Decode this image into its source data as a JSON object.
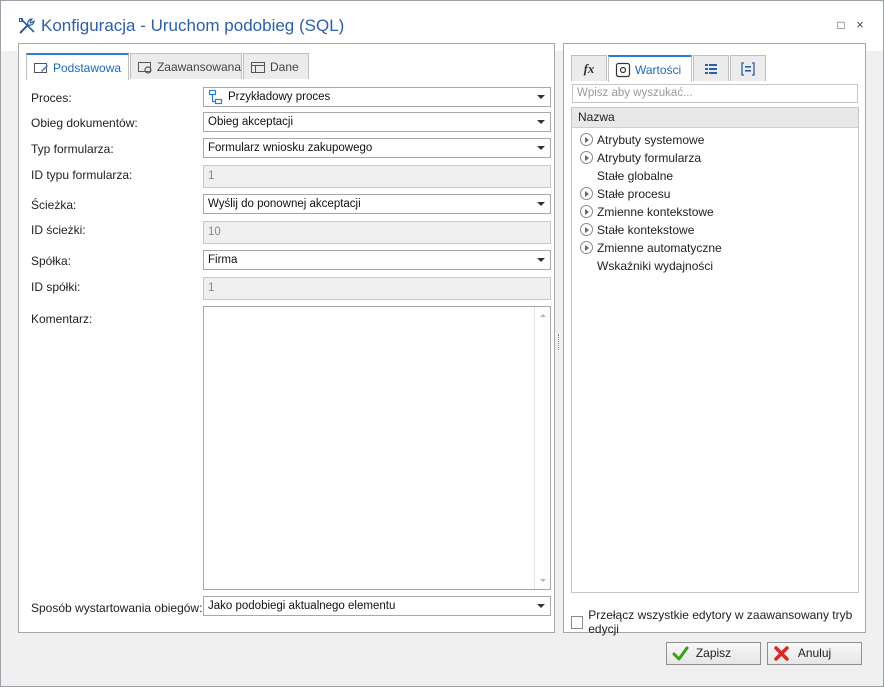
{
  "window": {
    "title": "Konfiguracja - Uruchom podobieg (SQL)",
    "maximize_glyph": "□",
    "close_glyph": "×"
  },
  "left_tabs": [
    {
      "label": "Podstawowa",
      "icon": "form-edit-icon",
      "active": true
    },
    {
      "label": "Zaawansowana",
      "icon": "form-settings-icon",
      "active": false
    },
    {
      "label": "Dane",
      "icon": "data-table-icon",
      "active": false
    }
  ],
  "form": {
    "proces": {
      "label": "Proces:",
      "value": "Przykładowy proces"
    },
    "obieg": {
      "label": "Obieg dokumentów:",
      "value": "Obieg akceptacji"
    },
    "typ_formularza": {
      "label": "Typ formularza:",
      "value": "Formularz wniosku zakupowego"
    },
    "id_typu": {
      "label": "ID typu formularza:",
      "value": "1"
    },
    "sciezka": {
      "label": "Ścieżka:",
      "value": "Wyślij do ponownej akceptacji"
    },
    "id_sciezki": {
      "label": "ID ścieżki:",
      "value": "10"
    },
    "spolka": {
      "label": "Spółka:",
      "value": "Firma"
    },
    "id_spolki": {
      "label": "ID spółki:",
      "value": "1"
    },
    "komentarz": {
      "label": "Komentarz:",
      "value": ""
    },
    "sposob": {
      "label": "Sposób wystartowania obiegów:",
      "value": "Jako podobiegi aktualnego elementu"
    }
  },
  "right_tabs": [
    {
      "label": "",
      "icon": "function-fx-icon",
      "glyph": "fx",
      "active": false
    },
    {
      "label": "Wartości",
      "icon": "values-icon",
      "active": true
    },
    {
      "label": "",
      "icon": "list-icon",
      "active": false
    },
    {
      "label": "",
      "icon": "bracket-list-icon",
      "active": false
    }
  ],
  "search": {
    "placeholder": "Wpisz aby wyszukać..."
  },
  "tree": {
    "header": "Nazwa",
    "items": [
      {
        "label": "Atrybuty systemowe",
        "expandable": true
      },
      {
        "label": "Atrybuty formularza",
        "expandable": true
      },
      {
        "label": "Stałe globalne",
        "expandable": false
      },
      {
        "label": "Stałe procesu",
        "expandable": true
      },
      {
        "label": "Zmienne kontekstowe",
        "expandable": true
      },
      {
        "label": "Stałe kontekstowe",
        "expandable": true
      },
      {
        "label": "Zmienne automatyczne",
        "expandable": true
      },
      {
        "label": "Wskaźniki wydajności",
        "expandable": false
      }
    ]
  },
  "advanced_toggle": {
    "label": "Przełącz wszystkie edytory w zaawansowany tryb edycji",
    "checked": false
  },
  "buttons": {
    "save": {
      "label": "Zapisz",
      "icon": "checkmark-icon"
    },
    "cancel": {
      "label": "Anuluj",
      "icon": "cancel-x-icon"
    }
  },
  "colors": {
    "title": "#2c5fa7",
    "active_tab": "#2b7cd3",
    "save_icon": "#3aa017",
    "cancel_icon": "#d42a2a"
  }
}
